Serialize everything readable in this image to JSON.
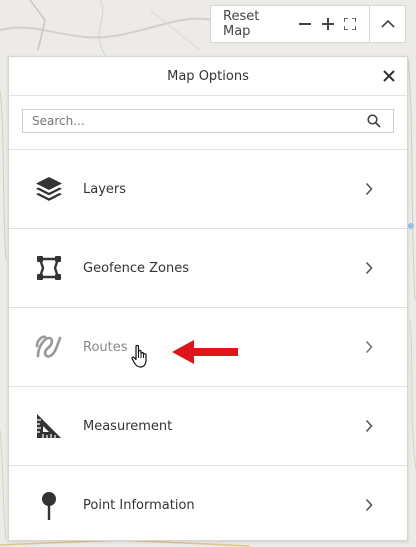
{
  "toolbar": {
    "reset_label": "Reset Map"
  },
  "panel": {
    "title": "Map Options"
  },
  "search": {
    "placeholder": "Search..."
  },
  "menu": {
    "items": [
      {
        "label": "Layers",
        "icon": "layers-icon"
      },
      {
        "label": "Geofence Zones",
        "icon": "geofence-icon"
      },
      {
        "label": "Routes",
        "icon": "route-icon"
      },
      {
        "label": "Measurement",
        "icon": "ruler-triangle-icon"
      },
      {
        "label": "Point Information",
        "icon": "map-pin-icon"
      }
    ]
  },
  "colors": {
    "icon_dark": "#333333",
    "icon_muted": "#999999",
    "annotation_arrow": "#e0151b"
  }
}
